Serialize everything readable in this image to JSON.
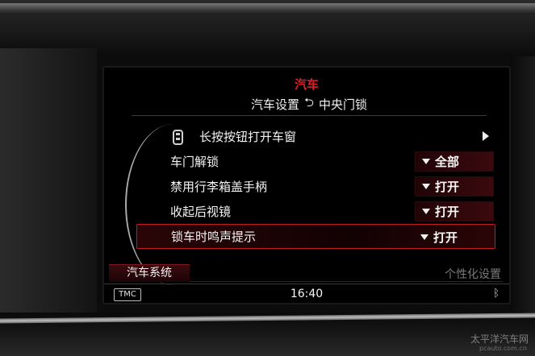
{
  "brand_title": "汽车",
  "breadcrumb": {
    "parent": "汽车设置",
    "back_glyph": "⮌",
    "current": "中央门锁"
  },
  "menu": [
    {
      "label": "长按按钮打开车窗",
      "type": "submenu",
      "icon": "remote-key-icon",
      "arrow_glyph": "▶"
    },
    {
      "label": "车门解锁",
      "value": "全部",
      "dropdown_glyph": "▾"
    },
    {
      "label": "禁用行李箱盖手柄",
      "value": "打开",
      "dropdown_glyph": "▾"
    },
    {
      "label": "收起后视镜",
      "value": "打开",
      "dropdown_glyph": "▾"
    },
    {
      "label": "锁车时鸣声提示",
      "value": "打开",
      "dropdown_glyph": "▾",
      "selected": true
    }
  ],
  "tabs": {
    "active": "汽车系统",
    "inactive": "个性化设置"
  },
  "status": {
    "tmc": "TMC",
    "time": "16:40",
    "bluetooth_glyph": "ᛒ"
  },
  "watermark": {
    "main": "太平洋汽车网",
    "sub": "pcauto.com.cn"
  },
  "colors": {
    "accent_red": "#d8202a",
    "selection_border": "#c01c24"
  }
}
